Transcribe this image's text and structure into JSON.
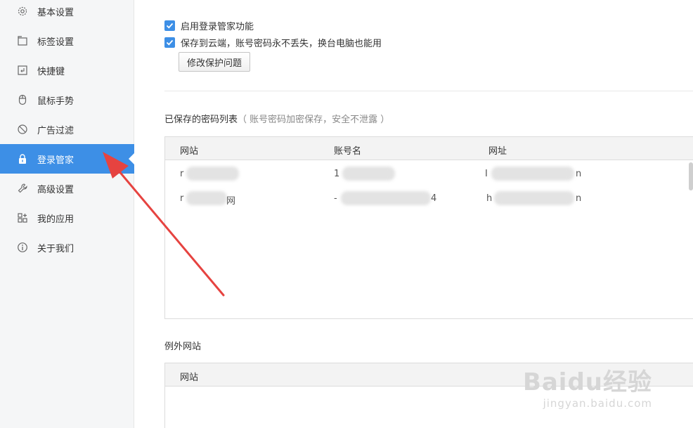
{
  "sidebar": {
    "items": [
      {
        "label": "基本设置",
        "icon": "gear-icon"
      },
      {
        "label": "标签设置",
        "icon": "tabs-icon"
      },
      {
        "label": "快捷键",
        "icon": "keyboard-icon"
      },
      {
        "label": "鼠标手势",
        "icon": "mouse-icon"
      },
      {
        "label": "广告过滤",
        "icon": "block-icon"
      },
      {
        "label": "登录管家",
        "icon": "lock-icon",
        "active": true
      },
      {
        "label": "高级设置",
        "icon": "wrench-icon"
      },
      {
        "label": "我的应用",
        "icon": "apps-icon"
      },
      {
        "label": "关于我们",
        "icon": "info-icon"
      }
    ]
  },
  "main": {
    "enable_label": "启用登录管家功能",
    "cloud_label": "保存到云端，账号密码永不丢失，换台电脑也能用",
    "modify_button": "修改保护问题",
    "saved_title": "已保存的密码列表",
    "saved_hint": "（ 账号密码加密保存，安全不泄露 ）",
    "saved_table": {
      "headers": [
        "网站",
        "账号名",
        "网址"
      ],
      "rows": [
        {
          "site": "r",
          "account": "1",
          "account_tail": "",
          "url": "I",
          "url_tail": "n"
        },
        {
          "site": "r",
          "site_tail": "网",
          "account": "-",
          "account_tail": "4",
          "url": "h",
          "url_tail": "n"
        }
      ]
    },
    "exception_title": "例外网站",
    "exception_table": {
      "headers": [
        "网站"
      ]
    }
  },
  "watermark": {
    "text": "Baidu经验",
    "sub": "jingyan.baidu.com"
  },
  "colors": {
    "accent": "#3d8fe6",
    "arrow": "#e64340"
  }
}
